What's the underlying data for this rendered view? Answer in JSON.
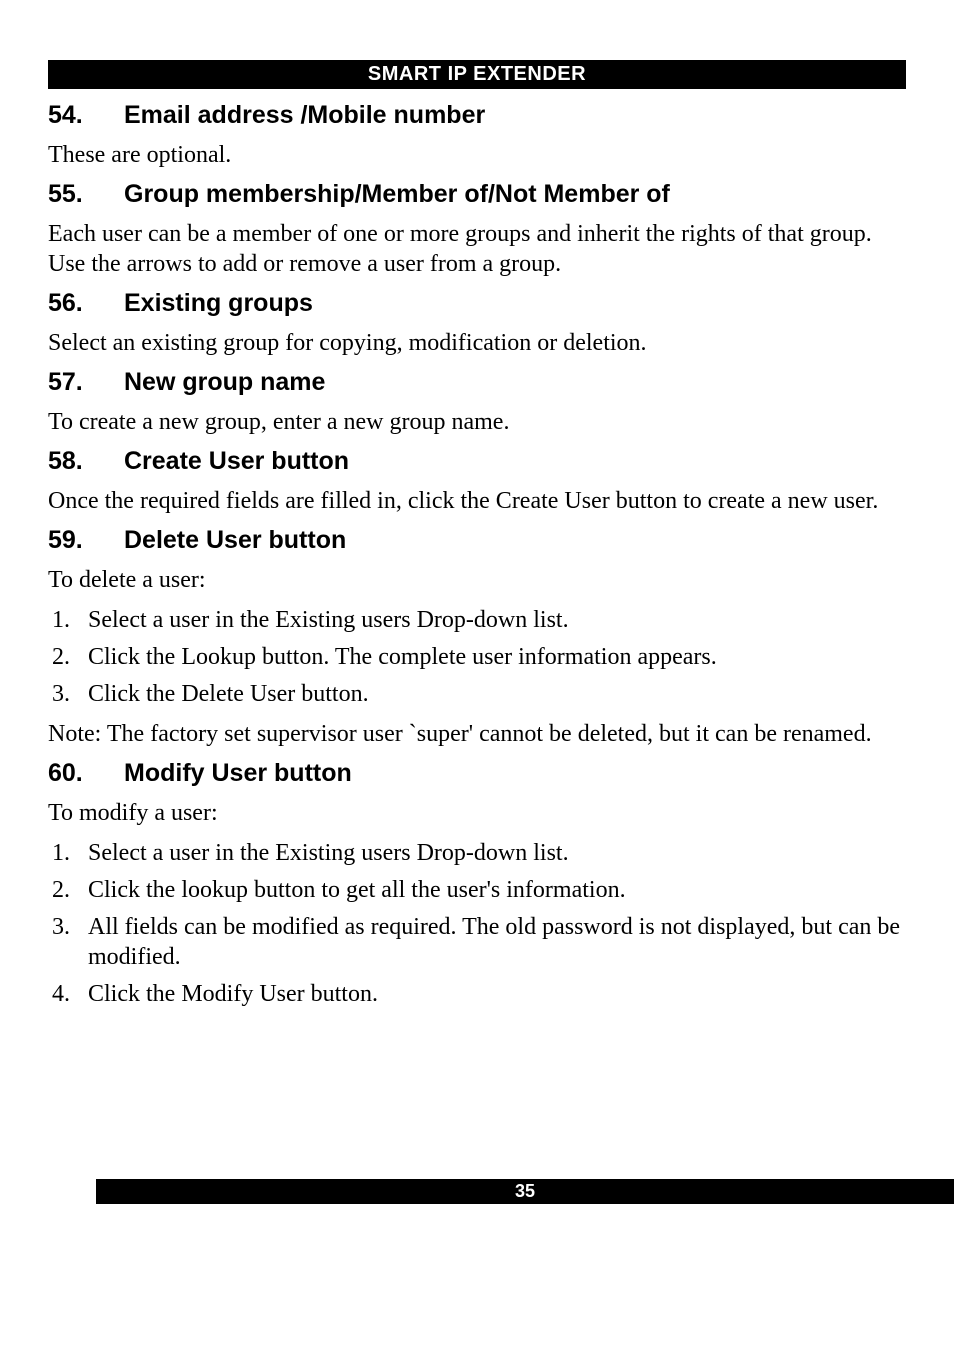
{
  "header": "SMART IP EXTENDER",
  "sections": [
    {
      "number": "54.",
      "title": "Email address /Mobile number",
      "paragraphs": [
        "These are optional."
      ],
      "list": []
    },
    {
      "number": "55.",
      "title": "Group membership/Member of/Not Member of",
      "paragraphs": [
        "Each user can be a member of one or more groups and inherit the rights of that group. Use the arrows to add or remove a user from a group."
      ],
      "list": []
    },
    {
      "number": "56.",
      "title": "Existing groups",
      "paragraphs": [
        "Select an existing group for copying, modification or deletion."
      ],
      "list": []
    },
    {
      "number": "57.",
      "title": "New group name",
      "paragraphs": [
        "To create a new group, enter a new group name."
      ],
      "list": []
    },
    {
      "number": "58.",
      "title": "Create User button",
      "paragraphs": [
        "Once the required fields are filled in, click the Create User button to create a new user."
      ],
      "list": []
    },
    {
      "number": "59.",
      "title": "Delete User button",
      "paragraphs": [
        "To delete a user:"
      ],
      "list": [
        {
          "marker": "1.",
          "text": "Select a user in the Existing users Drop-down list."
        },
        {
          "marker": "2.",
          "text": "Click the Lookup button. The complete user information appears."
        },
        {
          "marker": "3.",
          "text": "Click the Delete User button."
        }
      ],
      "afterListParagraphs": [
        "Note: The factory set supervisor user `super' cannot be deleted, but it can be renamed."
      ]
    },
    {
      "number": "60.",
      "title": "Modify User button",
      "paragraphs": [
        "To modify a user:"
      ],
      "list": [
        {
          "marker": "1.",
          "text": "Select a user in the Existing users Drop-down list."
        },
        {
          "marker": "2.",
          "text": "Click the lookup button to get all the user's information."
        },
        {
          "marker": "3.",
          "text": "All fields can be modified as required. The old password is not displayed, but can be modified."
        },
        {
          "marker": "4.",
          "text": "Click the Modify User button."
        }
      ]
    }
  ],
  "pageNumber": "35"
}
